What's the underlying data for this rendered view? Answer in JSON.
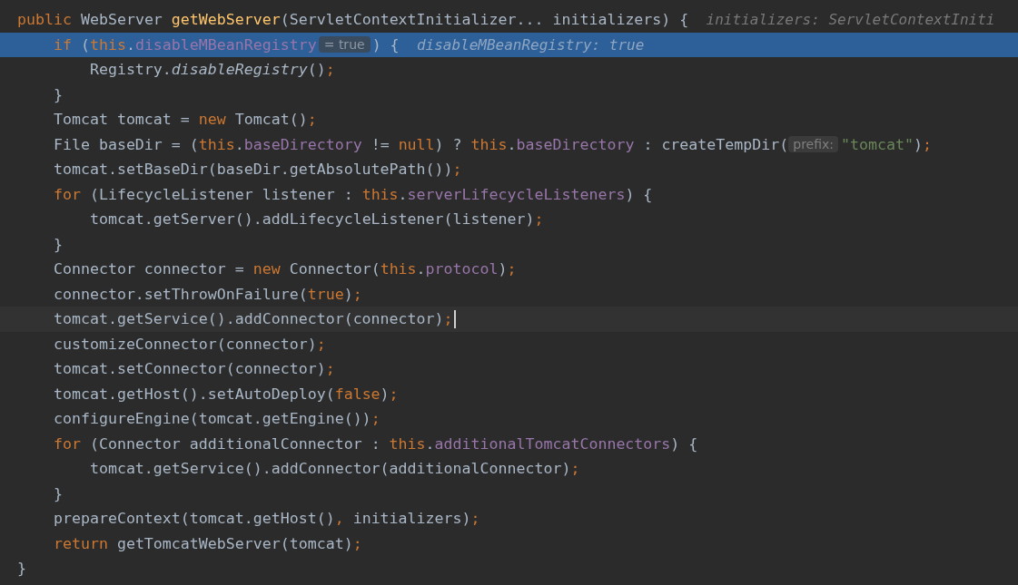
{
  "lines": [
    {
      "highlighted": false,
      "current": false,
      "tokens": [
        {
          "kind": "kw",
          "text": "public"
        },
        {
          "kind": "plain",
          "text": " WebServer "
        },
        {
          "kind": "method",
          "text": "getWebServer"
        },
        {
          "kind": "plain",
          "text": "(ServletContextInitializer... initializers) {"
        },
        {
          "kind": "value",
          "text": "initializers: ServletContextIniti"
        }
      ],
      "children": [
        {
          "highlighted": true,
          "current": false,
          "tokens": [
            {
              "kind": "kw",
              "text": "if"
            },
            {
              "kind": "plain",
              "text": " ("
            },
            {
              "kind": "kw",
              "text": "this"
            },
            {
              "kind": "plain",
              "text": "."
            },
            {
              "kind": "field",
              "text": "disableMBeanRegistry"
            },
            {
              "kind": "inlay",
              "text": "= true"
            },
            {
              "kind": "plain",
              "text": ") {"
            },
            {
              "kind": "value",
              "text": "disableMBeanRegistry: true"
            }
          ],
          "children": [
            {
              "highlighted": false,
              "current": false,
              "tokens": [
                {
                  "kind": "plain",
                  "text": "Registry."
                },
                {
                  "kind": "italic",
                  "text": "disableRegistry"
                },
                {
                  "kind": "plain",
                  "text": "()"
                },
                {
                  "kind": "punct",
                  "text": ";"
                }
              ]
            }
          ]
        },
        {
          "highlighted": false,
          "current": false,
          "tokens": [
            {
              "kind": "plain",
              "text": "}"
            }
          ]
        },
        {
          "highlighted": false,
          "current": false,
          "tokens": [
            {
              "kind": "plain",
              "text": "Tomcat tomcat = "
            },
            {
              "kind": "kw",
              "text": "new"
            },
            {
              "kind": "plain",
              "text": " Tomcat()"
            },
            {
              "kind": "punct",
              "text": ";"
            }
          ]
        },
        {
          "highlighted": false,
          "current": false,
          "tokens": [
            {
              "kind": "plain",
              "text": "File baseDir = ("
            },
            {
              "kind": "kw",
              "text": "this"
            },
            {
              "kind": "plain",
              "text": "."
            },
            {
              "kind": "field",
              "text": "baseDirectory"
            },
            {
              "kind": "plain",
              "text": " != "
            },
            {
              "kind": "kw",
              "text": "null"
            },
            {
              "kind": "plain",
              "text": ") ? "
            },
            {
              "kind": "kw",
              "text": "this"
            },
            {
              "kind": "plain",
              "text": "."
            },
            {
              "kind": "field",
              "text": "baseDirectory"
            },
            {
              "kind": "plain",
              "text": " : createTempDir("
            },
            {
              "kind": "param",
              "text": "prefix:"
            },
            {
              "kind": "string",
              "text": "\"tomcat\""
            },
            {
              "kind": "plain",
              "text": ")"
            },
            {
              "kind": "punct",
              "text": ";"
            }
          ]
        },
        {
          "highlighted": false,
          "current": false,
          "tokens": [
            {
              "kind": "plain",
              "text": "tomcat.setBaseDir(baseDir.getAbsolutePath())"
            },
            {
              "kind": "punct",
              "text": ";"
            }
          ]
        },
        {
          "highlighted": false,
          "current": false,
          "tokens": [
            {
              "kind": "kw",
              "text": "for"
            },
            {
              "kind": "plain",
              "text": " (LifecycleListener listener : "
            },
            {
              "kind": "kw",
              "text": "this"
            },
            {
              "kind": "plain",
              "text": "."
            },
            {
              "kind": "field",
              "text": "serverLifecycleListeners"
            },
            {
              "kind": "plain",
              "text": ") {"
            }
          ],
          "children": [
            {
              "highlighted": false,
              "current": false,
              "tokens": [
                {
                  "kind": "plain",
                  "text": "tomcat.getServer().addLifecycleListener(listener)"
                },
                {
                  "kind": "punct",
                  "text": ";"
                }
              ]
            }
          ]
        },
        {
          "highlighted": false,
          "current": false,
          "tokens": [
            {
              "kind": "plain",
              "text": "}"
            }
          ]
        },
        {
          "highlighted": false,
          "current": false,
          "tokens": [
            {
              "kind": "plain",
              "text": "Connector connector = "
            },
            {
              "kind": "kw",
              "text": "new"
            },
            {
              "kind": "plain",
              "text": " Connector("
            },
            {
              "kind": "kw",
              "text": "this"
            },
            {
              "kind": "plain",
              "text": "."
            },
            {
              "kind": "field",
              "text": "protocol"
            },
            {
              "kind": "plain",
              "text": ")"
            },
            {
              "kind": "punct",
              "text": ";"
            }
          ]
        },
        {
          "highlighted": false,
          "current": false,
          "tokens": [
            {
              "kind": "plain",
              "text": "connector.setThrowOnFailure("
            },
            {
              "kind": "kw",
              "text": "true"
            },
            {
              "kind": "plain",
              "text": ")"
            },
            {
              "kind": "punct",
              "text": ";"
            }
          ]
        },
        {
          "highlighted": false,
          "current": true,
          "tokens": [
            {
              "kind": "plain",
              "text": "tomcat.getService().addConnector(connector)"
            },
            {
              "kind": "punct",
              "text": ";"
            }
          ]
        },
        {
          "highlighted": false,
          "current": false,
          "tokens": [
            {
              "kind": "plain",
              "text": "customizeConnector(connector)"
            },
            {
              "kind": "punct",
              "text": ";"
            }
          ]
        },
        {
          "highlighted": false,
          "current": false,
          "tokens": [
            {
              "kind": "plain",
              "text": "tomcat.setConnector(connector)"
            },
            {
              "kind": "punct",
              "text": ";"
            }
          ]
        },
        {
          "highlighted": false,
          "current": false,
          "tokens": [
            {
              "kind": "plain",
              "text": "tomcat.getHost().setAutoDeploy("
            },
            {
              "kind": "kw",
              "text": "false"
            },
            {
              "kind": "plain",
              "text": ")"
            },
            {
              "kind": "punct",
              "text": ";"
            }
          ]
        },
        {
          "highlighted": false,
          "current": false,
          "tokens": [
            {
              "kind": "plain",
              "text": "configureEngine(tomcat.getEngine())"
            },
            {
              "kind": "punct",
              "text": ";"
            }
          ]
        },
        {
          "highlighted": false,
          "current": false,
          "tokens": [
            {
              "kind": "kw",
              "text": "for"
            },
            {
              "kind": "plain",
              "text": " (Connector additionalConnector : "
            },
            {
              "kind": "kw",
              "text": "this"
            },
            {
              "kind": "plain",
              "text": "."
            },
            {
              "kind": "field",
              "text": "additionalTomcatConnectors"
            },
            {
              "kind": "plain",
              "text": ") {"
            }
          ],
          "children": [
            {
              "highlighted": false,
              "current": false,
              "tokens": [
                {
                  "kind": "plain",
                  "text": "tomcat.getService().addConnector(additionalConnector)"
                },
                {
                  "kind": "punct",
                  "text": ";"
                }
              ]
            }
          ]
        },
        {
          "highlighted": false,
          "current": false,
          "tokens": [
            {
              "kind": "plain",
              "text": "}"
            }
          ]
        },
        {
          "highlighted": false,
          "current": false,
          "tokens": [
            {
              "kind": "plain",
              "text": "prepareContext(tomcat.getHost()"
            },
            {
              "kind": "punct",
              "text": ","
            },
            {
              "kind": "plain",
              "text": " initializers)"
            },
            {
              "kind": "punct",
              "text": ";"
            }
          ]
        },
        {
          "highlighted": false,
          "current": false,
          "tokens": [
            {
              "kind": "kw",
              "text": "return"
            },
            {
              "kind": "plain",
              "text": " getTomcatWebServer(tomcat)"
            },
            {
              "kind": "punct",
              "text": ";"
            }
          ]
        }
      ]
    },
    {
      "highlighted": false,
      "current": false,
      "tokens": [
        {
          "kind": "plain",
          "text": "}"
        }
      ]
    }
  ]
}
